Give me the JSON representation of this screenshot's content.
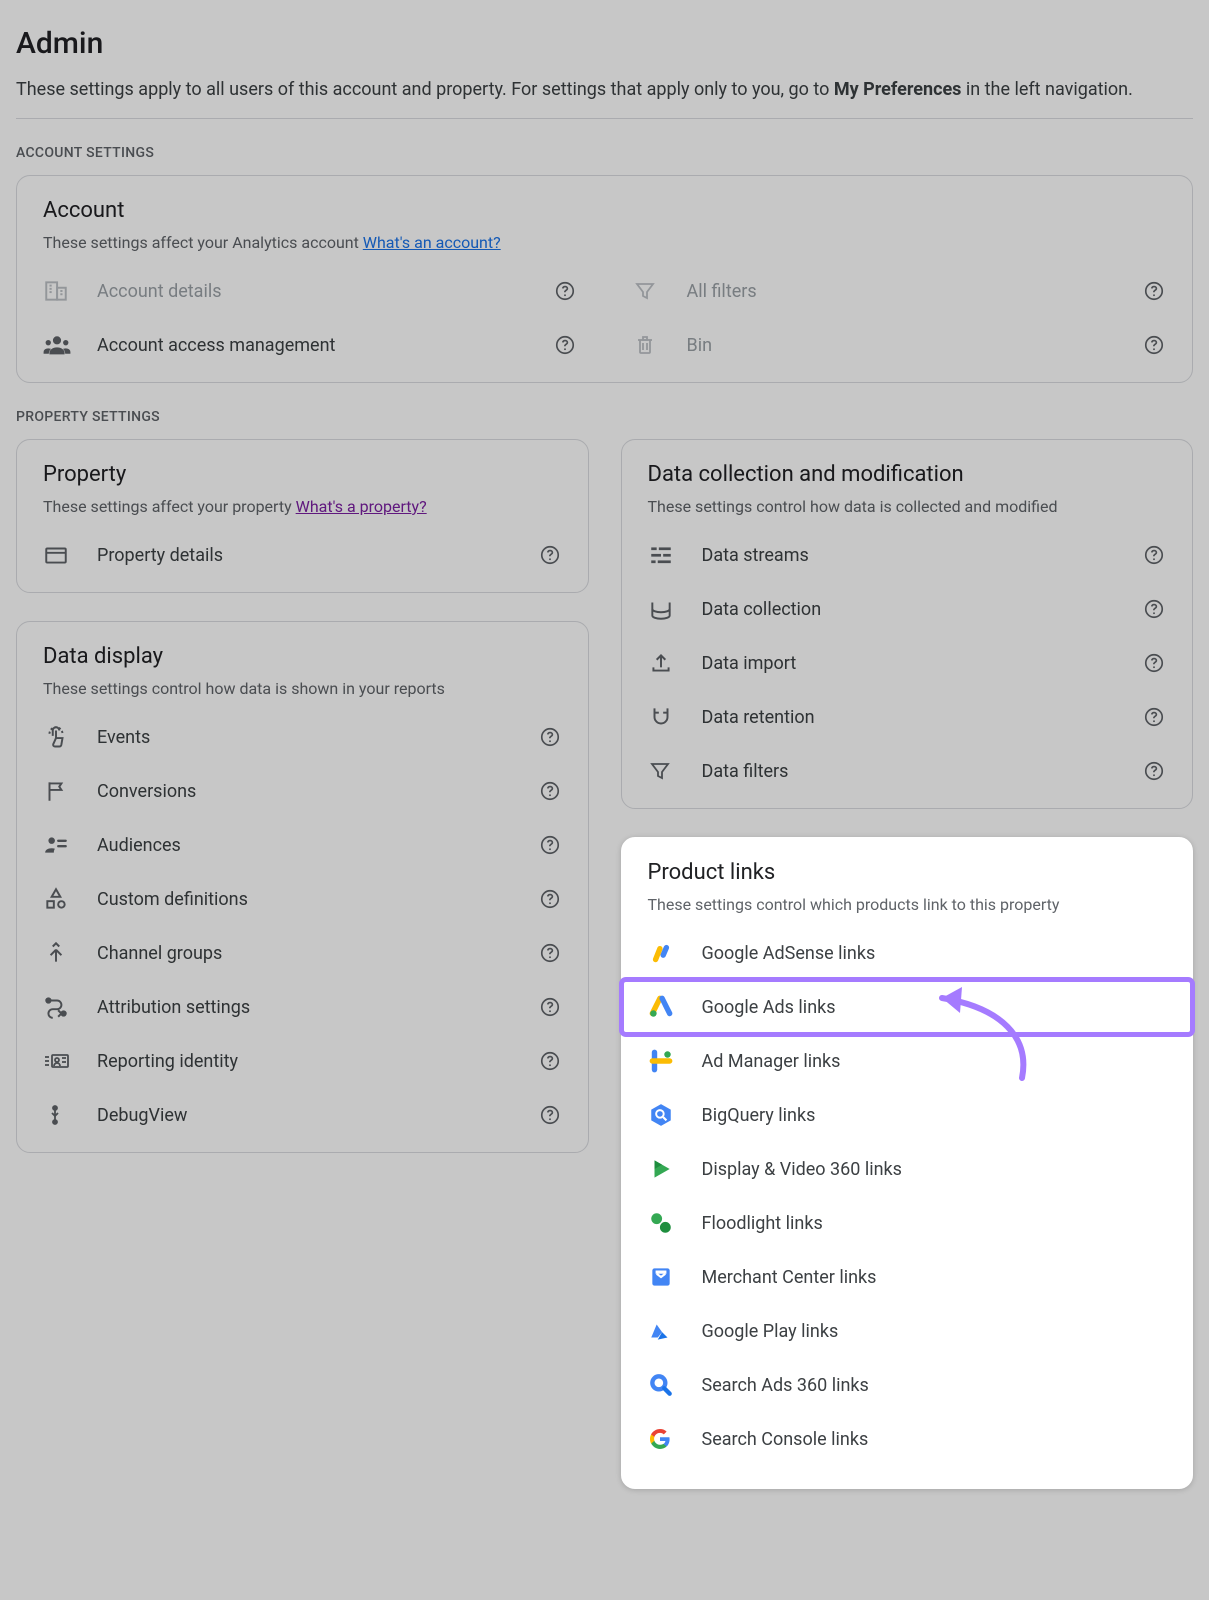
{
  "header": {
    "title": "Admin",
    "subtitle_pre": "These settings apply to all users of this account and property. For settings that apply only to you, go to ",
    "subtitle_bold": "My Preferences",
    "subtitle_post": " in the left navigation."
  },
  "sections": {
    "account_label": "ACCOUNT SETTINGS",
    "property_label": "PROPERTY SETTINGS"
  },
  "account_card": {
    "title": "Account",
    "desc": "These settings affect your Analytics account ",
    "link": "What's an account?",
    "items_left": [
      {
        "label": "Account details",
        "disabled": true
      },
      {
        "label": "Account access management",
        "disabled": false
      }
    ],
    "items_right": [
      {
        "label": "All filters",
        "disabled": true
      },
      {
        "label": "Bin",
        "disabled": true
      }
    ]
  },
  "property_card": {
    "title": "Property",
    "desc": "These settings affect your property ",
    "link": "What's a property?",
    "items": [
      {
        "label": "Property details"
      }
    ]
  },
  "display_card": {
    "title": "Data display",
    "desc": "These settings control how data is shown in your reports",
    "items": [
      {
        "label": "Events"
      },
      {
        "label": "Conversions"
      },
      {
        "label": "Audiences"
      },
      {
        "label": "Custom definitions"
      },
      {
        "label": "Channel groups"
      },
      {
        "label": "Attribution settings"
      },
      {
        "label": "Reporting identity"
      },
      {
        "label": "DebugView"
      }
    ]
  },
  "collection_card": {
    "title": "Data collection and modification",
    "desc": "These settings control how data is collected and modified",
    "items": [
      {
        "label": "Data streams"
      },
      {
        "label": "Data collection"
      },
      {
        "label": "Data import"
      },
      {
        "label": "Data retention"
      },
      {
        "label": "Data filters"
      }
    ]
  },
  "product_card": {
    "title": "Product links",
    "desc": "These settings control which products link to this property",
    "items": [
      {
        "label": "Google AdSense links"
      },
      {
        "label": "Google Ads links",
        "highlighted": true
      },
      {
        "label": "Ad Manager links"
      },
      {
        "label": "BigQuery links"
      },
      {
        "label": "Display & Video 360 links"
      },
      {
        "label": "Floodlight links"
      },
      {
        "label": "Merchant Center links"
      },
      {
        "label": "Google Play links"
      },
      {
        "label": "Search Ads 360 links"
      },
      {
        "label": "Search Console links"
      }
    ]
  }
}
